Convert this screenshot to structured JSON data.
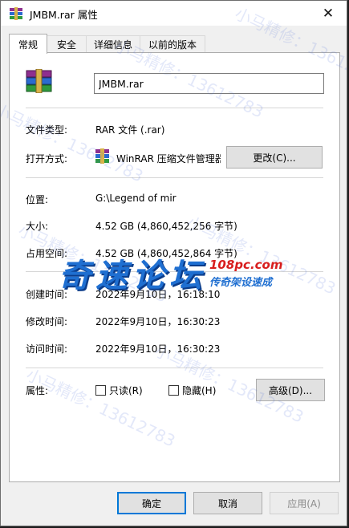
{
  "window": {
    "title": "JMBM.rar 属性",
    "close": "✕"
  },
  "tabs": [
    "常规",
    "安全",
    "详细信息",
    "以前的版本"
  ],
  "general": {
    "file_name": "JMBM.rar",
    "file_type": {
      "label": "文件类型:",
      "value": "RAR 文件 (.rar)"
    },
    "open_with": {
      "label": "打开方式:",
      "value": "WinRAR 压缩文件管理器",
      "change_button": "更改(C)..."
    },
    "location": {
      "label": "位置:",
      "value": "G:\\Legend of mir"
    },
    "size": {
      "label": "大小:",
      "value": "4.52 GB (4,860,452,256 字节)"
    },
    "size_on_disk": {
      "label": "占用空间:",
      "value": "4.52 GB (4,860,452,864 字节)"
    },
    "created": {
      "label": "创建时间:",
      "value": "2022年9月10日，16:18:10"
    },
    "modified": {
      "label": "修改时间:",
      "value": "2022年9月10日，16:30:23"
    },
    "accessed": {
      "label": "访问时间:",
      "value": "2022年9月10日，16:30:23"
    },
    "attributes": {
      "label": "属性:",
      "readonly": {
        "label": "只读(R)",
        "checked": false
      },
      "hidden": {
        "label": "隐藏(H)",
        "checked": false
      },
      "advanced_button": "高级(D)..."
    }
  },
  "footer": {
    "ok": "确定",
    "cancel": "取消",
    "apply": "应用(A)"
  },
  "overlay": {
    "logo_main": "奇速论坛",
    "logo_site": "108pc.com",
    "logo_sub": "传奇架设速成",
    "watermark_text": "小马精修：13612783"
  }
}
